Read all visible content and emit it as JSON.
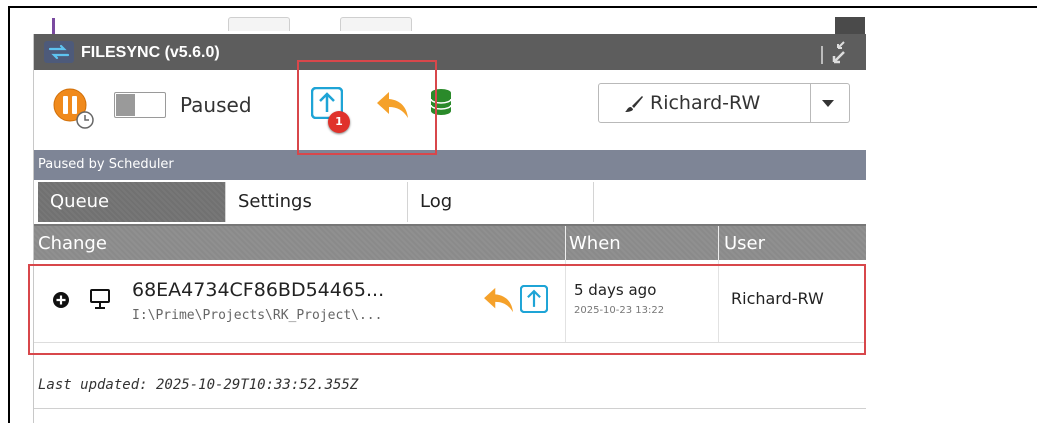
{
  "app": {
    "title": "FILESYNC (v5.6.0)"
  },
  "toolbar": {
    "status": "Paused",
    "upload_badge": "1",
    "user_select": {
      "value": "Richard-RW"
    }
  },
  "scheduler": {
    "text": "Paused by Scheduler"
  },
  "tabs": [
    {
      "label": "Queue",
      "active": true
    },
    {
      "label": "Settings",
      "active": false
    },
    {
      "label": "Log",
      "active": false
    }
  ],
  "table": {
    "headers": {
      "change": "Change",
      "when": "When",
      "user": "User"
    },
    "rows": [
      {
        "hash": "68EA4734CF86BD54465...",
        "path": "I:\\Prime\\Projects\\RK_Project\\...",
        "when_relative": "5 days ago",
        "when_absolute": "2025-10-23 13:22",
        "user": "Richard-RW"
      }
    ]
  },
  "footer": {
    "last_updated": "Last updated: 2025-10-29T10:33:52.355Z"
  },
  "colors": {
    "titlebar": "#5d5d5d",
    "scheduler_bar": "#7e8596",
    "highlight": "#d8474b",
    "pause_orange": "#f08a1c",
    "upload_blue": "#1ea4d6",
    "revert_orange": "#f5a12a",
    "database_green": "#2a8a2a",
    "badge_red": "#e0322b"
  }
}
